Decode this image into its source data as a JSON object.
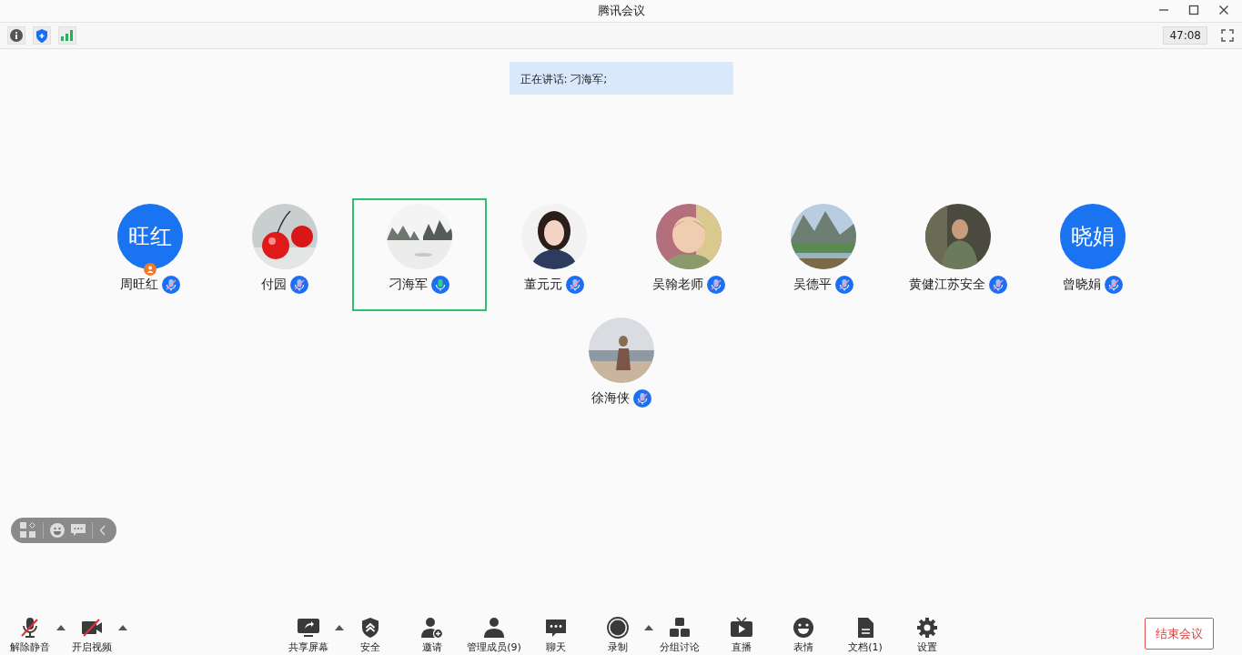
{
  "window": {
    "title": "腾讯会议"
  },
  "info_bar": {
    "timer": "47:08"
  },
  "speaking_banner": "正在讲话: 刁海军;",
  "participants": [
    {
      "name": "周旺红",
      "avatar": {
        "kind": "text",
        "text": "旺红"
      },
      "host": true,
      "muted": true,
      "speaking": false,
      "selected": false
    },
    {
      "name": "付园",
      "host": false,
      "muted": true,
      "speaking": false,
      "selected": false
    },
    {
      "name": "刁海军",
      "host": false,
      "muted": false,
      "speaking": true,
      "selected": true
    },
    {
      "name": "董元元",
      "host": false,
      "muted": true,
      "speaking": false,
      "selected": false
    },
    {
      "name": "吴翰老师",
      "host": false,
      "muted": true,
      "speaking": false,
      "selected": false
    },
    {
      "name": "吴德平",
      "host": false,
      "muted": true,
      "speaking": false,
      "selected": false
    },
    {
      "name": "黄健江苏安全",
      "host": false,
      "muted": true,
      "speaking": false,
      "selected": false
    },
    {
      "name": "曾晓娟",
      "avatar": {
        "kind": "text",
        "text": "晓娟"
      },
      "host": false,
      "muted": true,
      "speaking": false,
      "selected": false
    },
    {
      "name": "徐海侠",
      "host": false,
      "muted": true,
      "speaking": false,
      "selected": false
    }
  ],
  "toolbar": {
    "left": [
      {
        "label": "解除静音",
        "off": true,
        "has_menu": true
      },
      {
        "label": "开启视频",
        "off": true,
        "has_menu": true
      }
    ],
    "center": [
      {
        "label": "共享屏幕",
        "has_menu": true
      },
      {
        "label": "安全",
        "has_menu": false
      },
      {
        "label": "邀请",
        "has_menu": false
      },
      {
        "label": "管理成员(9)",
        "has_menu": false
      },
      {
        "label": "聊天",
        "has_menu": false
      },
      {
        "label": "录制",
        "has_menu": true
      },
      {
        "label": "分组讨论",
        "has_menu": false
      },
      {
        "label": "直播",
        "has_menu": false
      },
      {
        "label": "表情",
        "has_menu": false
      },
      {
        "label": "文档(1)",
        "has_menu": false
      },
      {
        "label": "设置",
        "has_menu": false
      }
    ]
  },
  "end_button": "结束会议"
}
